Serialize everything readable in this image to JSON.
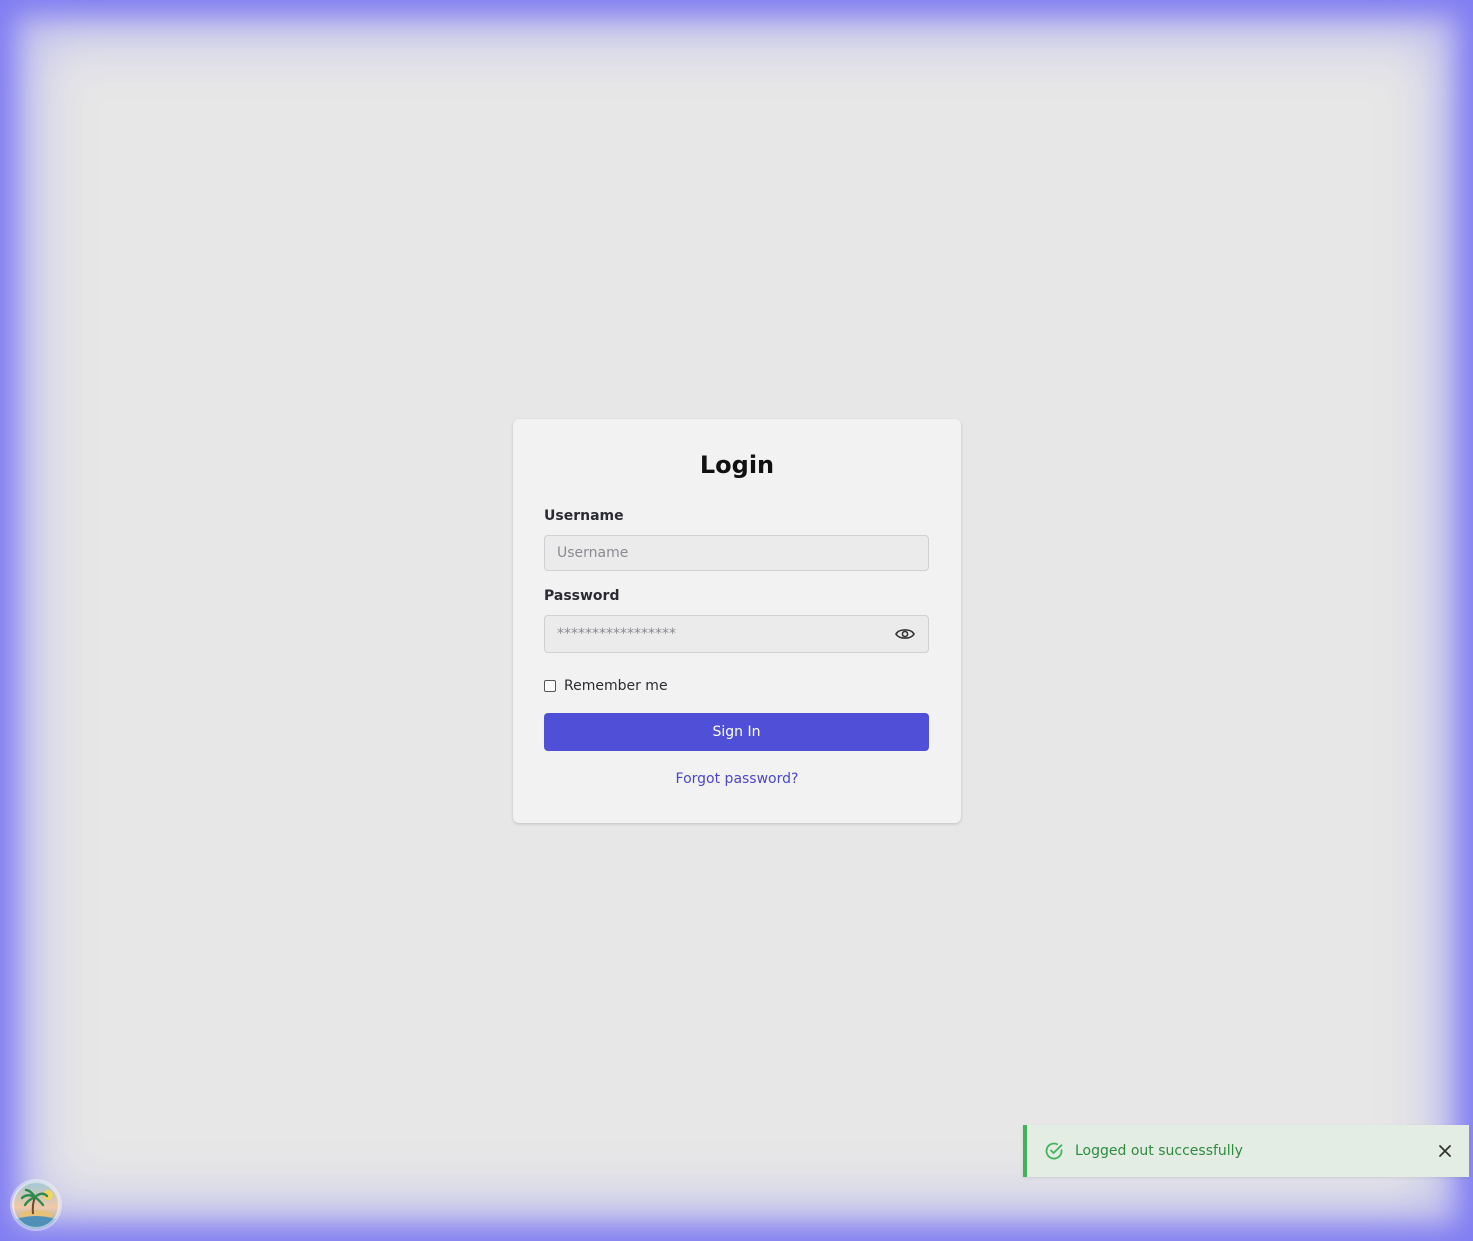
{
  "login": {
    "title": "Login",
    "username_label": "Username",
    "username_placeholder": "Username",
    "password_label": "Password",
    "password_placeholder": "*****************",
    "remember_label": "Remember me",
    "remember_checked": false,
    "signin_label": "Sign In",
    "forgot_label": "Forgot password?"
  },
  "toast": {
    "message": "Logged out successfully",
    "status": "success"
  },
  "icons": {
    "password_toggle": "eye-icon",
    "toast_status": "check-circle-icon",
    "toast_close": "close-icon",
    "avatar": "tropical-island-avatar"
  },
  "colors": {
    "accent": "#4f4fd8",
    "link": "#4a47c9",
    "success": "#3fb55a",
    "success_bg": "#e3ede4",
    "frame_glow": "#7f7cf2"
  }
}
